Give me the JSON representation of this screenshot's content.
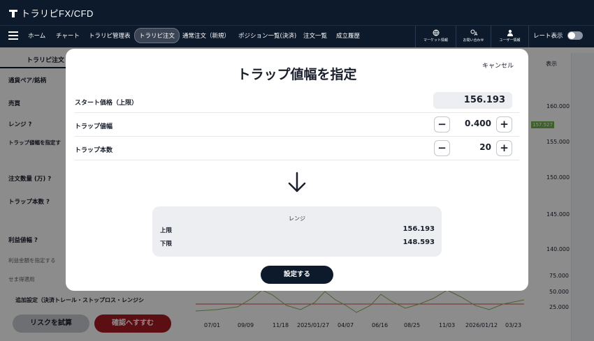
{
  "app": {
    "logo": "トラリピFX/CFD"
  },
  "nav": {
    "items": [
      "ホーム",
      "チャート",
      "トラリピ管理表",
      "トラリピ注文",
      "通常注文（新規）",
      "ポジション一覧(決済)",
      "注文一覧",
      "成立履歴"
    ],
    "active_index": 3,
    "right": [
      {
        "label": "マーケット情報",
        "icon": "globe-icon"
      },
      {
        "label": "お問い合わせ",
        "icon": "contact-icon"
      },
      {
        "label": "ユーザー情報",
        "icon": "user-icon"
      }
    ],
    "rate_label": "レート表示"
  },
  "left_panel": {
    "tab": "トラリピ注文",
    "rows": [
      "通貨ペア/銘柄",
      "売買",
      "レンジ ?",
      "トラップ値幅を指定す",
      "注文数量 (万) ?",
      "トラップ本数 ?",
      "利益値幅 ?"
    ],
    "small_rows": [
      "利益金額を指定する",
      "せま得適用"
    ],
    "extra": "追加設定（決済トレール・ストップロス・レンジシ",
    "risk_button": "リスクを試算",
    "confirm_button": "確認へすすむ"
  },
  "chart": {
    "display_label": "表示",
    "y_ticks": [
      "160.000",
      "155.000",
      "150.000",
      "145.000",
      "140.000"
    ],
    "current_price": "157.527",
    "sub_ticks": [
      "75.000",
      "50.000",
      "25.000"
    ],
    "x_ticks": [
      "07/01",
      "09/09",
      "11/18",
      "2025/01/27",
      "04/07",
      "06/16",
      "08/25",
      "11/03",
      "2026/01/12",
      "03/23"
    ]
  },
  "modal": {
    "title": "トラップ値幅を指定",
    "cancel": "キャンセル",
    "start_price_label": "スタート価格（上限）",
    "start_price": "156.193",
    "trap_width_label": "トラップ値幅",
    "trap_width": "0.400",
    "trap_count_label": "トラップ本数",
    "trap_count": "20",
    "range": {
      "title": "レンジ",
      "upper_label": "上限",
      "upper": "156.193",
      "lower_label": "下限",
      "lower": "148.593"
    },
    "submit": "設定する"
  },
  "colors": {
    "header": "#0c1a2c",
    "confirm": "#a81c24",
    "price_tag": "#6fb34a"
  }
}
